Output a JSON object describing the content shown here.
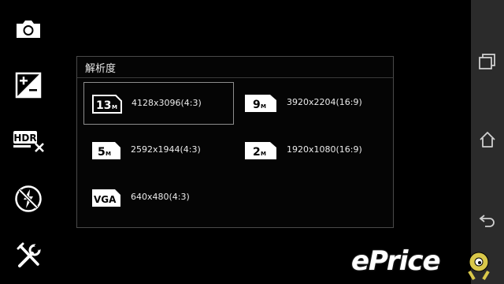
{
  "dialog": {
    "title": "解析度",
    "options": [
      {
        "badge": "13",
        "suffix": "M",
        "label": "4128x3096(4:3)",
        "selected": true
      },
      {
        "badge": "9",
        "suffix": "M",
        "label": "3920x2204(16:9)",
        "selected": false
      },
      {
        "badge": "5",
        "suffix": "M",
        "label": "2592x1944(4:3)",
        "selected": false
      },
      {
        "badge": "2",
        "suffix": "M",
        "label": "1920x1080(16:9)",
        "selected": false
      },
      {
        "badge": "VGA",
        "suffix": "",
        "label": "640x480(4:3)",
        "selected": false
      }
    ]
  },
  "left_toolbar": {
    "items": [
      "camera-icon",
      "exposure-icon",
      "hdr-off-icon",
      "flash-off-icon",
      "settings-tools-icon"
    ],
    "hdr_text": "HDR"
  },
  "navbar": {
    "items": [
      "recent-apps-icon",
      "home-icon",
      "back-icon"
    ]
  },
  "watermark": {
    "text": "ePrice"
  },
  "colors": {
    "background": "#000000",
    "navbar": "#2b2b2b",
    "dialog_border": "#4a4a4a",
    "selected_border": "#8d8d8d"
  }
}
